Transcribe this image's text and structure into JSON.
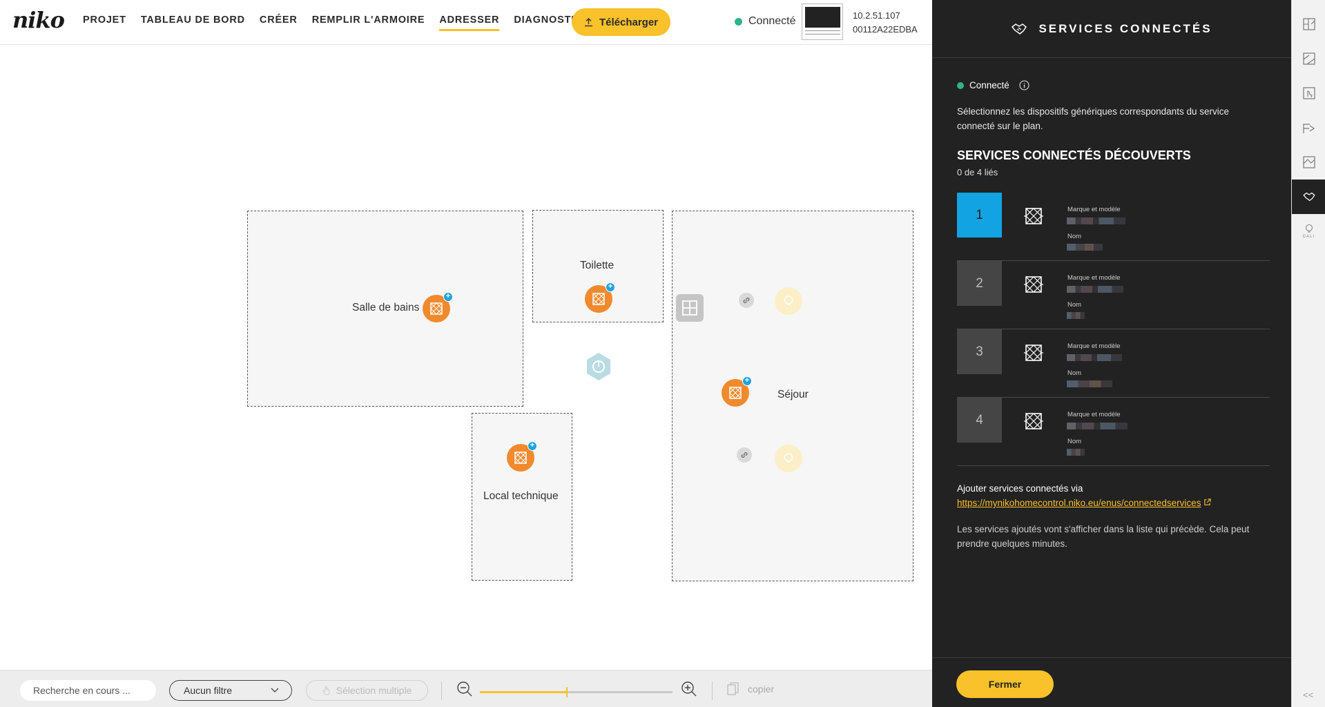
{
  "app": {
    "logo": "niko"
  },
  "nav": {
    "items": [
      {
        "label": "PROJET"
      },
      {
        "label": "TABLEAU DE BORD"
      },
      {
        "label": "CRÉER"
      },
      {
        "label": "REMPLIR L'ARMOIRE"
      },
      {
        "label": "ADRESSER",
        "active": true
      },
      {
        "label": "DIAGNOSTIC"
      }
    ],
    "download_label": "Télécharger"
  },
  "connection": {
    "status": "Connecté",
    "ip": "10.2.51.107",
    "mac": "00112A22EDBA"
  },
  "floorplan": {
    "rooms": [
      {
        "name": "Salle de bains"
      },
      {
        "name": "Toilette"
      },
      {
        "name": "Local technique"
      },
      {
        "name": "Séjour"
      }
    ]
  },
  "toolbar": {
    "search_placeholder": "Recherche en cours ...",
    "filter_value": "Aucun filtre",
    "multi_select_label": "Sélection multiple",
    "zoom_level": 0.45,
    "copy_label": "copier"
  },
  "panel": {
    "title": "SERVICES CONNECTÉS",
    "status": "Connecté",
    "description": "Sélectionnez les dispositifs génériques correspondants du service connecté sur le plan.",
    "discovered_heading": "SERVICES CONNECTÉS DÉCOUVERTS",
    "linked_count": "0 de 4 liés",
    "services": [
      {
        "number": "1",
        "brand_label": "Marque et modèle",
        "name_label": "Nom",
        "selected": true
      },
      {
        "number": "2",
        "brand_label": "Marque et modèle",
        "name_label": "Nom",
        "selected": false
      },
      {
        "number": "3",
        "brand_label": "Marque et modèle",
        "name_label": "Nom",
        "selected": false
      },
      {
        "number": "4",
        "brand_label": "Marque et modèle",
        "name_label": "Nom",
        "selected": false
      }
    ],
    "add_via_label": "Ajouter services connectés via",
    "add_via_link": "https://mynikohomecontrol.niko.eu/enus/connectedservices",
    "note": "Les services ajoutés vont s'afficher dans la liste qui précède. Cela peut prendre quelques minutes.",
    "close_label": "Fermer"
  },
  "rail": {
    "collapse_label": "<<",
    "dali_label": "DALI"
  },
  "colors": {
    "accent": "#f9c12a",
    "device": "#f18a2d",
    "selected": "#12a3e3",
    "panel_bg": "#222222",
    "status_ok": "#2db38a"
  }
}
